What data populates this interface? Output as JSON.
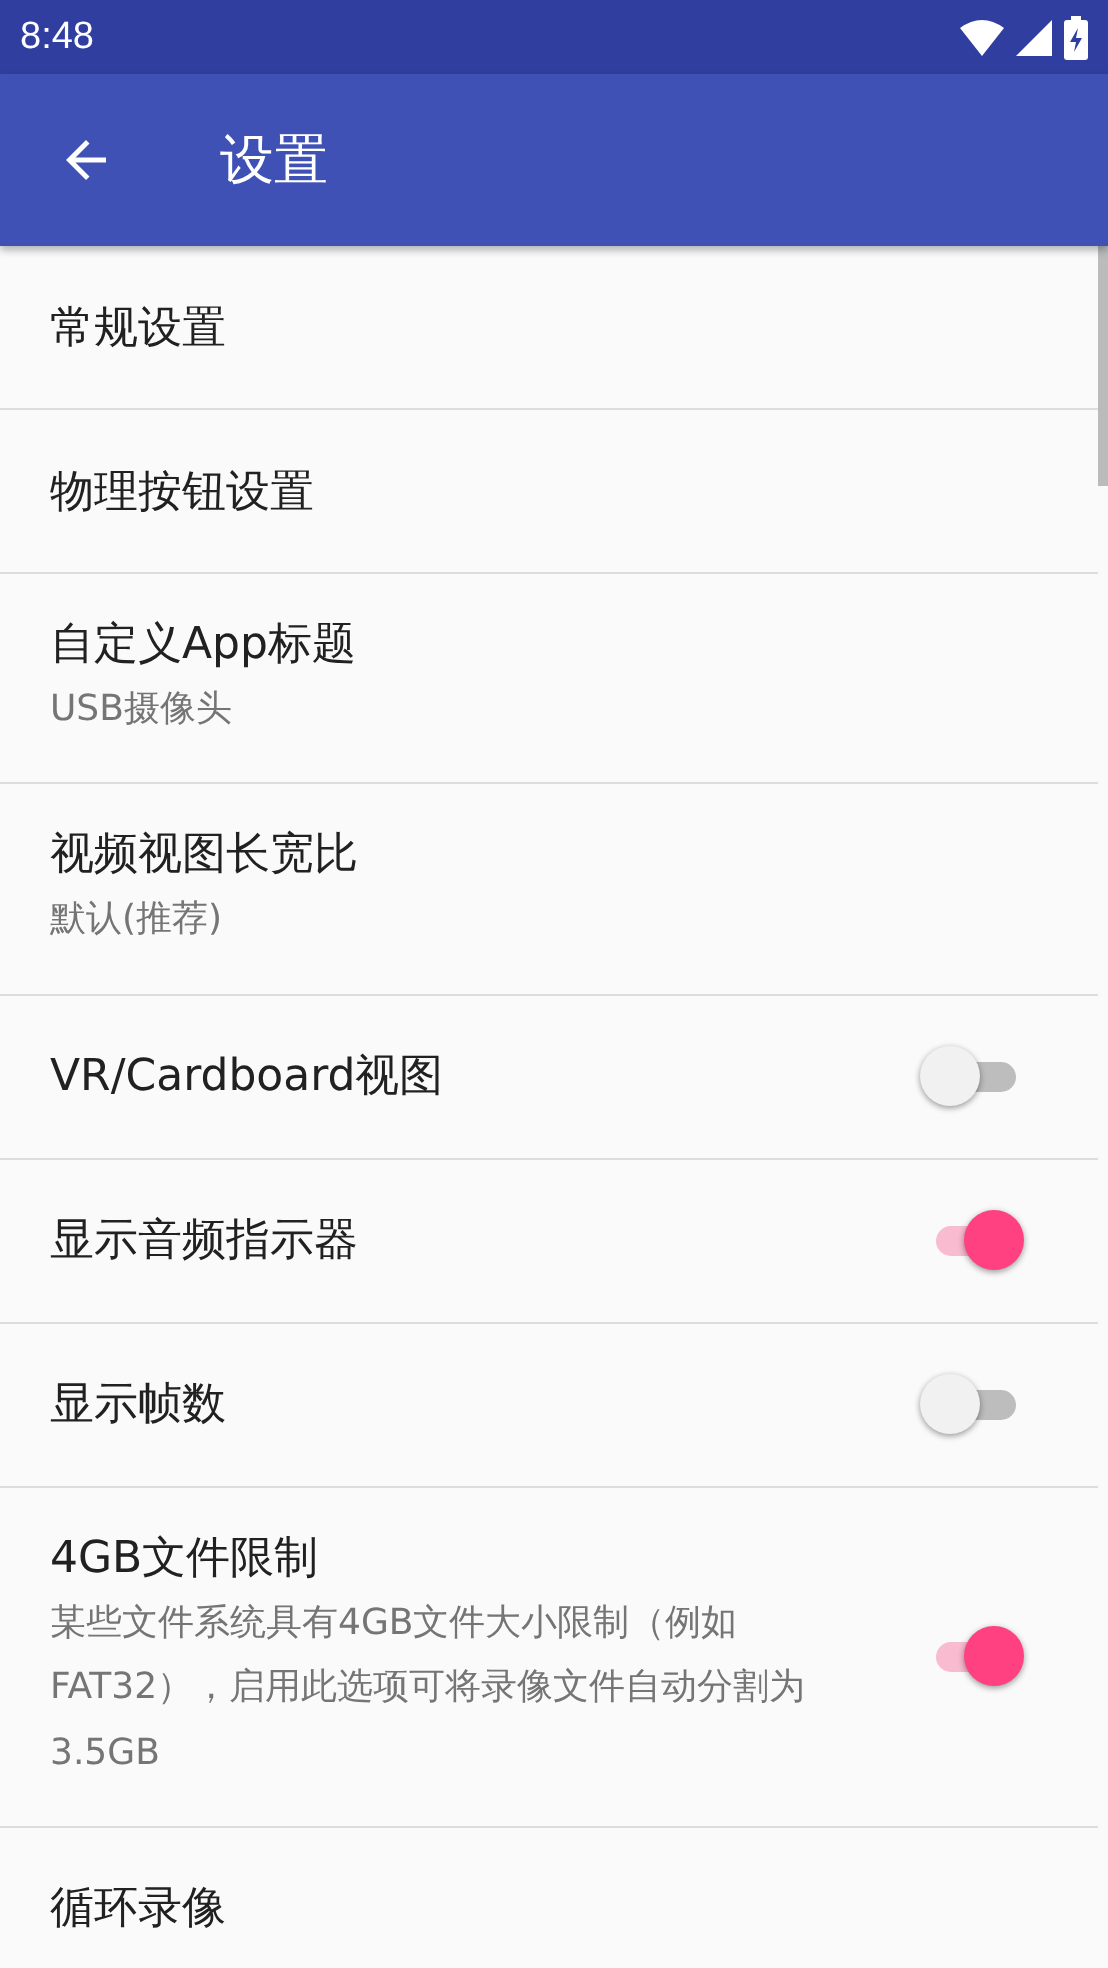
{
  "status_bar": {
    "time": "8:48"
  },
  "app_bar": {
    "title": "设置"
  },
  "settings": [
    {
      "kind": "link",
      "title": "常规设置"
    },
    {
      "kind": "link",
      "title": "物理按钮设置"
    },
    {
      "kind": "link",
      "title": "自定义App标题",
      "summary": "USB摄像头"
    },
    {
      "kind": "link",
      "title": "视频视图长宽比",
      "summary": "默认(推荐)"
    },
    {
      "kind": "switch",
      "title": "VR/Cardboard视图",
      "on": false
    },
    {
      "kind": "switch",
      "title": "显示音频指示器",
      "on": true
    },
    {
      "kind": "switch",
      "title": "显示帧数",
      "on": false
    },
    {
      "kind": "switch",
      "title": "4GB文件限制",
      "summary": "某些文件系统具有4GB文件大小限制（例如FAT32），启用此选项可将录像文件自动分割为3.5GB",
      "on": true
    },
    {
      "kind": "link",
      "title": "循环录像"
    }
  ]
}
